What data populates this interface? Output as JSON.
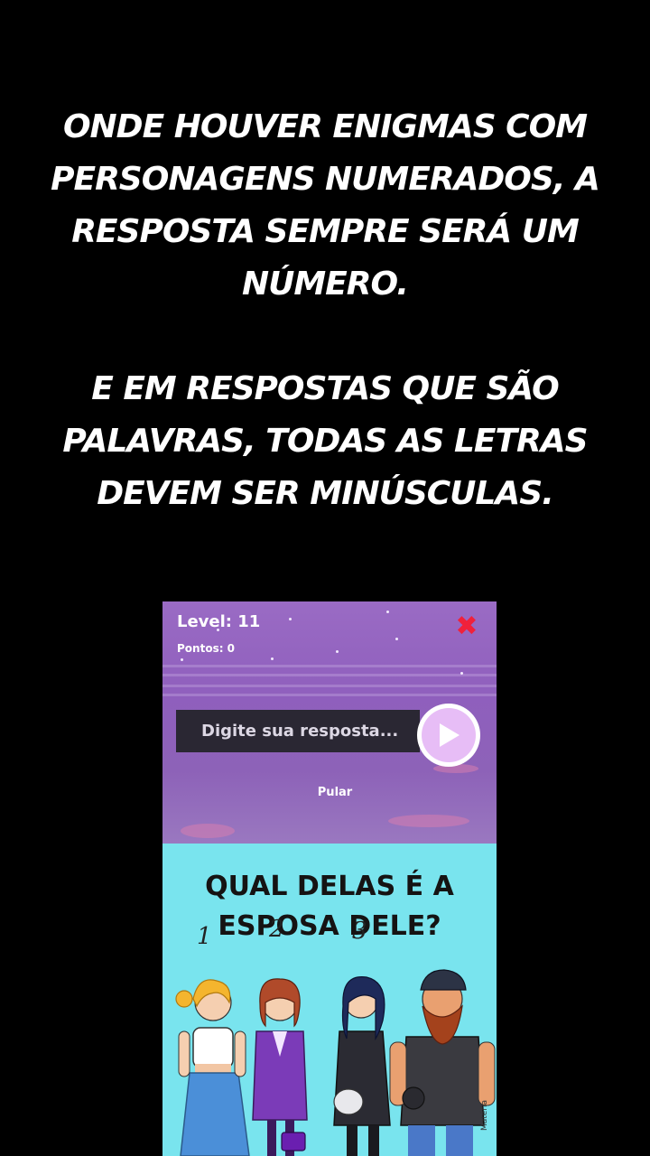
{
  "instructions": {
    "paragraph1": "ONDE HOUVER ENIGMAS COM PERSONAGENS NUMERADOS, A RESPOSTA SEMPRE SERÁ UM NÚMERO.",
    "paragraph2": "E EM RESPOSTAS QUE SÃO PALAVRAS, TODAS AS LETRAS DEVEM SER MINÚSCULAS."
  },
  "game": {
    "level_label": "Level: 11",
    "points_label": "Pontos: 0",
    "close_icon": "close-x-icon",
    "answer_placeholder": "Digite sua resposta...",
    "send_icon": "play-icon",
    "skip_label": "Pular",
    "colors": {
      "header_bg": "#9a6bc4",
      "close": "#f0213b",
      "input_bg": "#2a2733",
      "send_fill": "#e7bdf6",
      "puzzle_bg": "#79e4ee"
    }
  },
  "puzzle": {
    "question_line1": "QUAL DELAS É A",
    "question_line2": "ESPOSA DELE?",
    "numbers": [
      "1",
      "2",
      "3"
    ],
    "credit": "Matéria"
  }
}
